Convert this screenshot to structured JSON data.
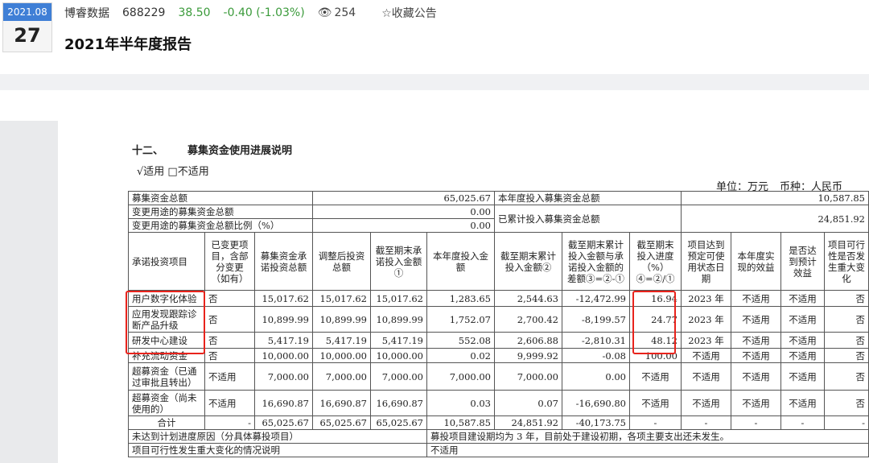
{
  "header": {
    "date_month": "2021.08",
    "date_day": "27",
    "stock_name": "博睿数据",
    "stock_code": "688229",
    "price": "38.50",
    "change": "-0.40 (-1.03%)",
    "views": "254",
    "favorite_label": "☆收藏公告",
    "report_title": "2021年半年度报告",
    "colors": {
      "badge": "#3f7fd6",
      "change": "#3a9a3a",
      "highlight": "#e8231c"
    }
  },
  "section": {
    "number": "十二、",
    "title": "募集资金使用进展说明",
    "applicability": "√适用 □不适用",
    "unit_label": "单位：万元",
    "currency_label": "币种：人民币"
  },
  "summary": {
    "total_label": "募集资金总额",
    "total_value": "65,025.67",
    "changed_label": "变更用途的募集资金总额",
    "changed_value": "0.00",
    "ratio_label": "变更用途的募集资金总额比例（%）",
    "ratio_value": "0.00",
    "year_invest_label": "本年度投入募集资金总额",
    "year_invest_value": "10,587.85",
    "cumulative_label": "已累计投入募集资金总额",
    "cumulative_value": "24,851.92"
  },
  "table": {
    "headers": [
      "承诺投资项目",
      "已变更项目，含部分变更（如有）",
      "募集资金承诺投资总额",
      "调整后投资总额",
      "截至期末承诺投入金额①",
      "本年度投入金额",
      "截至期末累计投入金额②",
      "截至期末累计投入金额与承诺投入金额的差额③=②-①",
      "截至期末投入进度（%）④=②/①",
      "项目达到预定可使用状态日期",
      "本年度实现的效益",
      "是否达到预计效益",
      "项目可行性是否发生重大变化"
    ],
    "rows": [
      [
        "用户数字化体验",
        "否",
        "15,017.62",
        "15,017.62",
        "15,017.62",
        "1,283.65",
        "2,544.63",
        "-12,472.99",
        "16.94",
        "2023 年",
        "不适用",
        "不适用",
        "否"
      ],
      [
        "应用发现跟踪诊断产品升级",
        "否",
        "10,899.99",
        "10,899.99",
        "10,899.99",
        "1,752.07",
        "2,700.42",
        "-8,199.57",
        "24.77",
        "2023 年",
        "不适用",
        "不适用",
        "否"
      ],
      [
        "研发中心建设",
        "否",
        "5,417.19",
        "5,417.19",
        "5,417.19",
        "552.08",
        "2,606.88",
        "-2,810.31",
        "48.12",
        "2023 年",
        "不适用",
        "不适用",
        "否"
      ],
      [
        "补充流动资金",
        "否",
        "10,000.00",
        "10,000.00",
        "10,000.00",
        "0.02",
        "9,999.92",
        "-0.08",
        "100.00",
        "不适用",
        "不适用",
        "不适用",
        "否"
      ],
      [
        "超募资金（已通过审批且转出）",
        "不适用",
        "7,000.00",
        "7,000.00",
        "7,000.00",
        "7,000.00",
        "7,000.00",
        "0.00",
        "不适用",
        "不适用",
        "不适用",
        "不适用",
        "否"
      ],
      [
        "超募资金（尚未使用的）",
        "不适用",
        "16,690.87",
        "16,690.87",
        "16,690.87",
        "0.03",
        "0.07",
        "-16,690.80",
        "不适用",
        "不适用",
        "不适用",
        "不适用",
        "否"
      ],
      [
        "合计",
        "-",
        "65,025.67",
        "65,025.67",
        "65,025.67",
        "10,587.85",
        "24,851.92",
        "-40,173.75",
        "-",
        "-",
        "-",
        "-",
        "-"
      ]
    ],
    "footer": [
      {
        "label": "未达到计划进度原因（分具体募投项目）",
        "value": "募投项目建设期均为 3 年，目前处于建设初期，各项主要支出还未发生。"
      },
      {
        "label": "项目可行性发生重大变化的情况说明",
        "value": "不适用"
      }
    ]
  }
}
